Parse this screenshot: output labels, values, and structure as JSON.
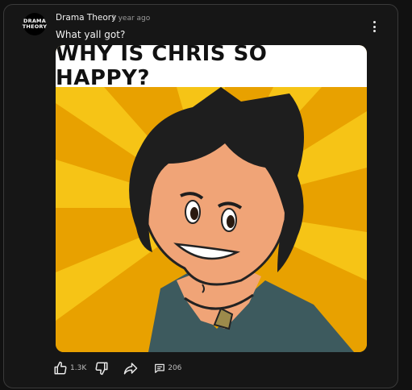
{
  "post": {
    "avatar_line1": "DRAMA",
    "avatar_line2": "THEORY",
    "author": "Drama Theory",
    "time": "1 year ago",
    "text": "What yall got?",
    "image_banner": "WHY IS CHRIS SO HAPPY?"
  },
  "actions": {
    "likes": "1.3K",
    "comments": "206"
  },
  "icons": [
    "thumbs-up-icon",
    "thumbs-down-icon",
    "share-icon",
    "comment-icon",
    "more-vert-icon"
  ],
  "colors": {
    "background": "#111111",
    "card_border": "#3a3a3a",
    "image_bg": "#e8a100"
  }
}
